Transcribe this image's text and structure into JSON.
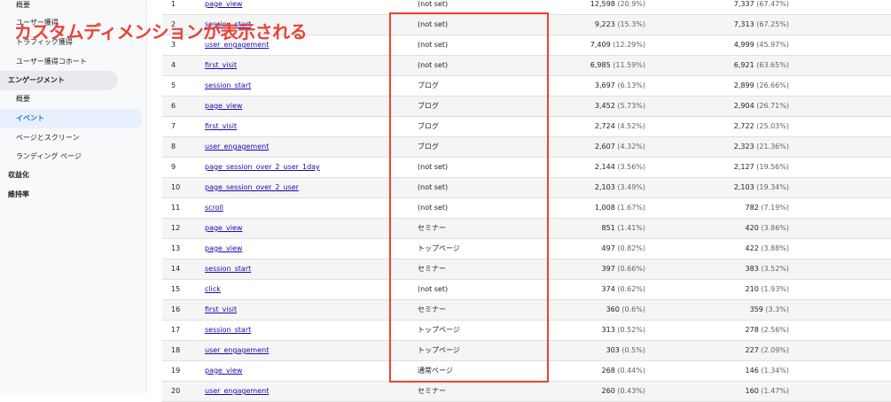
{
  "sidebar": {
    "items": [
      {
        "label": "概要"
      },
      {
        "label": "ユーザー獲得"
      },
      {
        "label": "トラフィック獲得"
      },
      {
        "label": "ユーザー獲得コホート"
      },
      {
        "label": "エンゲージメント"
      },
      {
        "label": "概要"
      },
      {
        "label": "イベント"
      },
      {
        "label": "ページとスクリーン"
      },
      {
        "label": "ランディング ページ"
      },
      {
        "label": "収益化"
      },
      {
        "label": "維持率"
      }
    ]
  },
  "overlay": {
    "caption": "カスタムディメンションが表示される",
    "highlight_color": "#ea4335"
  },
  "table": {
    "rows": [
      {
        "idx": "1",
        "name": "page_view",
        "dim": "(not set)",
        "v1": "12,598",
        "p1": "(20.9%)",
        "v2": "7,337",
        "p2": "(67.47%)"
      },
      {
        "idx": "2",
        "name": "session_start",
        "dim": "(not set)",
        "v1": "9,223",
        "p1": "(15.3%)",
        "v2": "7,313",
        "p2": "(67.25%)"
      },
      {
        "idx": "3",
        "name": "user_engagement",
        "dim": "(not set)",
        "v1": "7,409",
        "p1": "(12.29%)",
        "v2": "4,999",
        "p2": "(45.97%)"
      },
      {
        "idx": "4",
        "name": "first_visit",
        "dim": "(not set)",
        "v1": "6,985",
        "p1": "(11.59%)",
        "v2": "6,921",
        "p2": "(63.65%)"
      },
      {
        "idx": "5",
        "name": "session_start",
        "dim": "ブログ",
        "v1": "3,697",
        "p1": "(6.13%)",
        "v2": "2,899",
        "p2": "(26.66%)"
      },
      {
        "idx": "6",
        "name": "page_view",
        "dim": "ブログ",
        "v1": "3,452",
        "p1": "(5.73%)",
        "v2": "2,904",
        "p2": "(26.71%)"
      },
      {
        "idx": "7",
        "name": "first_visit",
        "dim": "ブログ",
        "v1": "2,724",
        "p1": "(4.52%)",
        "v2": "2,722",
        "p2": "(25.03%)"
      },
      {
        "idx": "8",
        "name": "user_engagement",
        "dim": "ブログ",
        "v1": "2,607",
        "p1": "(4.32%)",
        "v2": "2,323",
        "p2": "(21.36%)"
      },
      {
        "idx": "9",
        "name": "page_session_over_2_user_1day",
        "dim": "(not set)",
        "v1": "2,144",
        "p1": "(3.56%)",
        "v2": "2,127",
        "p2": "(19.56%)"
      },
      {
        "idx": "10",
        "name": "page_session_over_2_user",
        "dim": "(not set)",
        "v1": "2,103",
        "p1": "(3.49%)",
        "v2": "2,103",
        "p2": "(19.34%)"
      },
      {
        "idx": "11",
        "name": "scroll",
        "dim": "(not set)",
        "v1": "1,008",
        "p1": "(1.67%)",
        "v2": "782",
        "p2": "(7.19%)"
      },
      {
        "idx": "12",
        "name": "page_view",
        "dim": "セミナー",
        "v1": "851",
        "p1": "(1.41%)",
        "v2": "420",
        "p2": "(3.86%)"
      },
      {
        "idx": "13",
        "name": "page_view",
        "dim": "トップページ",
        "v1": "497",
        "p1": "(0.82%)",
        "v2": "422",
        "p2": "(3.88%)"
      },
      {
        "idx": "14",
        "name": "session_start",
        "dim": "セミナー",
        "v1": "397",
        "p1": "(0.66%)",
        "v2": "383",
        "p2": "(3.52%)"
      },
      {
        "idx": "15",
        "name": "click",
        "dim": "(not set)",
        "v1": "374",
        "p1": "(0.62%)",
        "v2": "210",
        "p2": "(1.93%)"
      },
      {
        "idx": "16",
        "name": "first_visit",
        "dim": "セミナー",
        "v1": "360",
        "p1": "(0.6%)",
        "v2": "359",
        "p2": "(3.3%)"
      },
      {
        "idx": "17",
        "name": "session_start",
        "dim": "トップページ",
        "v1": "313",
        "p1": "(0.52%)",
        "v2": "278",
        "p2": "(2.56%)"
      },
      {
        "idx": "18",
        "name": "user_engagement",
        "dim": "トップページ",
        "v1": "303",
        "p1": "(0.5%)",
        "v2": "227",
        "p2": "(2.09%)"
      },
      {
        "idx": "19",
        "name": "page_view",
        "dim": "通常ページ",
        "v1": "268",
        "p1": "(0.44%)",
        "v2": "146",
        "p2": "(1.34%)"
      },
      {
        "idx": "20",
        "name": "user_engagement",
        "dim": "セミナー",
        "v1": "260",
        "p1": "(0.43%)",
        "v2": "160",
        "p2": "(1.47%)"
      }
    ]
  }
}
